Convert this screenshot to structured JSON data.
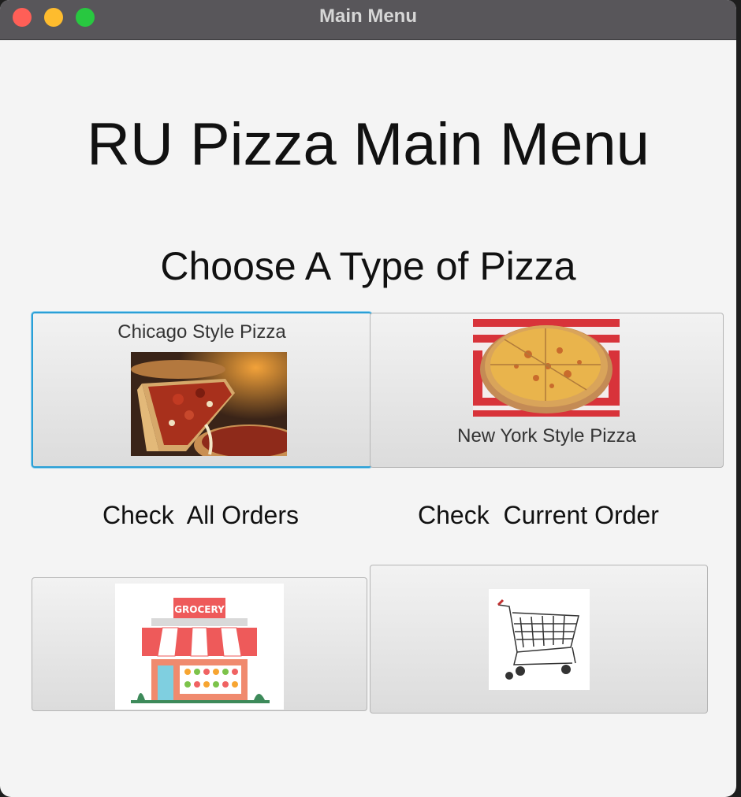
{
  "window": {
    "title": "Main Menu"
  },
  "main_title": "RU Pizza Main Menu",
  "choose_label": "Choose A Type of Pizza",
  "buttons": {
    "chicago": {
      "label": "Chicago Style Pizza",
      "image_icon": "chicago-deep-dish-pizza-image"
    },
    "new_york": {
      "label": "New York Style Pizza",
      "image_icon": "new-york-pizza-image"
    },
    "all_orders": {
      "image_icon": "grocery-store-image"
    },
    "current_order": {
      "image_icon": "shopping-cart-image"
    }
  },
  "labels": {
    "all_orders": "Check  All Orders",
    "current_order": "Check  Current Order"
  },
  "colors": {
    "titlebar": "#58565a",
    "window_bg": "#f4f4f4",
    "focus_ring": "#2a9fd6",
    "close": "#ff5f57",
    "minimize": "#febc2e",
    "maximize": "#28c840"
  }
}
